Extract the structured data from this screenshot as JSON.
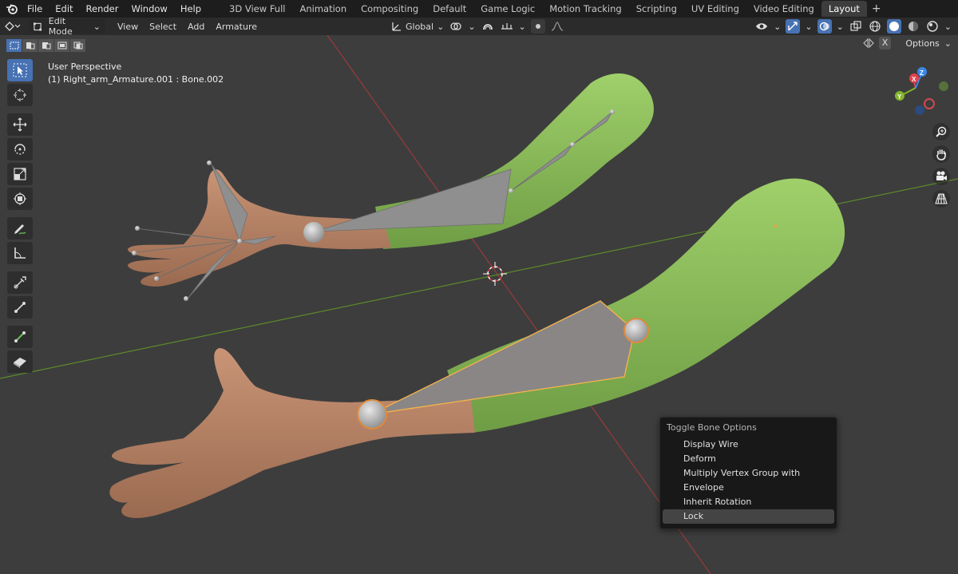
{
  "menubar": {
    "items": [
      "File",
      "Edit",
      "Render",
      "Window",
      "Help"
    ],
    "workspaces": [
      "3D View Full",
      "Animation",
      "Compositing",
      "Default",
      "Game Logic",
      "Motion Tracking",
      "Scripting",
      "UV Editing",
      "Video Editing",
      "Layout"
    ],
    "active_workspace": "Layout",
    "add_tab": "+"
  },
  "header": {
    "mode": "Edit Mode",
    "menus": [
      "View",
      "Select",
      "Add",
      "Armature"
    ],
    "orientation": "Global",
    "options_label": "Options",
    "x_mirror": "X"
  },
  "viewport": {
    "perspective": "User Perspective",
    "object_info": "(1) Right_arm_Armature.001 : Bone.002"
  },
  "gizmo": {
    "x": "X",
    "y": "Y",
    "z": "Z"
  },
  "context_menu": {
    "title": "Toggle Bone Options",
    "items": [
      "Display Wire",
      "Deform",
      "Multiply Vertex Group with Envelope",
      "Inherit Rotation",
      "Lock"
    ],
    "hovered": "Lock"
  },
  "colors": {
    "accent": "#4772b3",
    "axis_x": "#e4414a",
    "axis_y": "#83b52b",
    "axis_z": "#3b86e8",
    "sleeve": "#8cbf5d",
    "skin": "#b98366",
    "bone": "#8f8f8f",
    "selected_bone": "#f0b24d"
  }
}
